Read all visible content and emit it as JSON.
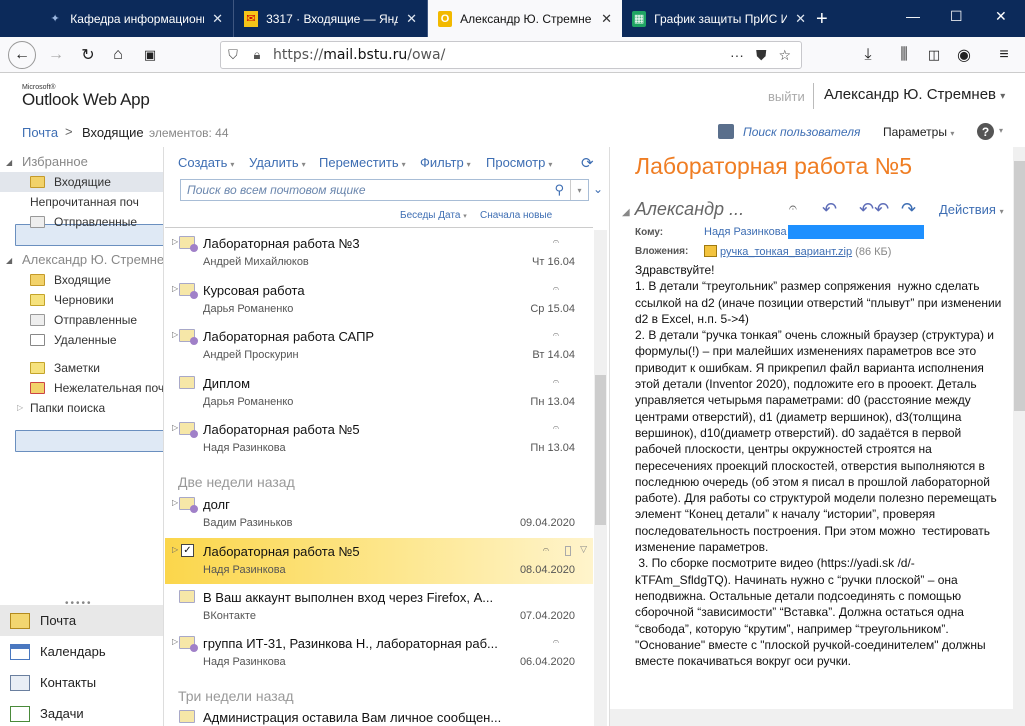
{
  "browser": {
    "tabs": [
      {
        "title": "Кафедра информационн",
        "favicon": "bird-icon",
        "active": false
      },
      {
        "title": "3317 · Входящие — Янде",
        "favicon": "yandex-mail-icon",
        "active": false
      },
      {
        "title": "Александр Ю. Стремне",
        "favicon": "outlook-icon",
        "active": true
      },
      {
        "title": "График защиты ПрИС И",
        "favicon": "sheets-icon",
        "active": false
      }
    ],
    "url_prefix": "https://",
    "url_host": "mail.bstu.ru",
    "url_path": "/owa/"
  },
  "header": {
    "logo_ms": "Microsoft®",
    "logo_app": "Outlook Web App",
    "signout": "выйти",
    "username": "Александр Ю. Стремнев",
    "username_arrow": "▾"
  },
  "breadcrumb": {
    "root": "Почта",
    "sep": ">",
    "folder": "Входящие",
    "count": "элементов: 44",
    "find_user": "Поиск пользователя",
    "options": "Параметры",
    "help": "?"
  },
  "nav": {
    "favorites_title": "Избранное",
    "favorites": [
      {
        "label": "Входящие",
        "icon": "inbox-icon"
      },
      {
        "label": "Непрочитанная поч",
        "icon": "unread-folder-icon"
      },
      {
        "label": "Отправленные",
        "icon": "sent-folder-icon"
      }
    ],
    "mailbox_title": "Александр Ю. Стремнев",
    "folders": [
      {
        "label": "Входящие",
        "icon": "inbox-icon"
      },
      {
        "label": "Черновики",
        "icon": "drafts-icon"
      },
      {
        "label": "Отправленные",
        "icon": "sent-folder-icon"
      },
      {
        "label": "Удаленные",
        "icon": "deleted-icon"
      },
      {
        "label": "Заметки",
        "icon": "notes-icon"
      },
      {
        "label": "Нежелательная поч",
        "icon": "junk-icon"
      },
      {
        "label": "Папки поиска",
        "icon": "search-folder-icon"
      }
    ],
    "modules": [
      {
        "label": "Почта",
        "icon": "mail-icon"
      },
      {
        "label": "Календарь",
        "icon": "calendar-icon"
      },
      {
        "label": "Контакты",
        "icon": "contacts-icon"
      },
      {
        "label": "Задачи",
        "icon": "tasks-icon"
      }
    ]
  },
  "toolbar": {
    "create": "Создать",
    "delete": "Удалить",
    "move": "Переместить",
    "filter": "Фильтр",
    "view": "Просмотр"
  },
  "search": {
    "placeholder": "Поиск во всем почтовом ящике"
  },
  "sort": {
    "by": "Беседы Дата",
    "order": "Сначала новые"
  },
  "messages": [
    {
      "subject": "Лабораторная работа №3",
      "from": "Андрей Михайлюков",
      "date": "Чт 16.04",
      "attach": true
    },
    {
      "subject": "Курсовая работа",
      "from": "Дарья Романенко",
      "date": "Ср 15.04",
      "attach": true
    },
    {
      "subject": "Лабораторная работа САПР",
      "from": "Андрей Проскурин",
      "date": "Вт 14.04",
      "attach": true
    },
    {
      "subject": "Диплом",
      "from": "Дарья Романенко",
      "date": "Пн 13.04",
      "attach": true
    },
    {
      "subject": "Лабораторная работа №5",
      "from": "Надя Разинкова",
      "date": "Пн 13.04",
      "attach": true
    }
  ],
  "group2_title": "Две недели назад",
  "messages2": [
    {
      "subject": "долг",
      "from": "Вадим Разиньков",
      "date": "09.04.2020",
      "attach": false
    },
    {
      "subject": "Лабораторная работа №5",
      "from": "Надя Разинкова",
      "date": "08.04.2020",
      "attach": true
    },
    {
      "subject": "В Ваш аккаунт выполнен вход через Firefox, А...",
      "from": "ВКонтакте",
      "date": "07.04.2020",
      "attach": false
    },
    {
      "subject": "группа ИТ-31, Разинкова Н., лабораторная раб...",
      "from": "Надя Разинкова",
      "date": "06.04.2020",
      "attach": true
    }
  ],
  "group3_title": "Три недели назад",
  "messages3": [
    {
      "subject": "Администрация оставила Вам личное сообщен..."
    }
  ],
  "reading": {
    "subject": "Лабораторная работа №5",
    "from": "Александр ...",
    "actions": "Действия",
    "to_label": "Кому:",
    "to": "Надя Разинкова",
    "attachments_label": "Вложения:",
    "attachment_name": "ручка_тонкая_вариант.zip",
    "attachment_size": "(86 КБ)",
    "body": [
      "Здравствуйте!",
      "1. В детали “треугольник” размер сопряжения  нужно сделать ссылкой на d2 (иначе позиции отверстий “плывут” при изменении d2 в Excel, н.п. 5->4)",
      "2. В детали “ручка тонкая” очень сложный браузер (структура) и формулы(!) – при малейших изменениях параметров все это приводит к ошибкам. Я прикрепил файл варианта исполнения этой детали (Inventor 2020), подложите его в прооект. Деталь управляется четырьмя параметрами: d0 (расстояние между центрами отверстий), d1 (диаметр вершинок), d3(толщина вершинок), d10(диаметр отверстий). d0 задаётся в первой рабочей плоскости, центры окружностей строятся на пересечениях проекций плоскостей, отверстия выполняются в последнюю очередь (об этом я писал в прошлой лабораторной работе). Для работы со структурой модели полезно перемещать элемент “Конец детали” к началу “истории”, проверяя последовательность построения. При этом можно  тестировать изменение параметров.",
      " 3. По сборке посмотрите видео (https://yadi.sk /d/-kTFAm_SfldgTQ). Начинать нужно с “ручки плоской” – она неподвижна. Остальные детали подсоединять с помощью сборочной “зависимости” “Вставка”. Должна остаться одна “свобода”, которую “крутим”, например “треугольником”. \"Основание\" вместе с \"плоской ручкой-соединителем\" должны вместе покачиваться вокруг оси ручки."
    ]
  },
  "colors": {
    "tabbar": "#0c2a5a",
    "link": "#3e6eb3",
    "subject_orange": "#ef7d23",
    "selected_row": "#fbd64b"
  }
}
